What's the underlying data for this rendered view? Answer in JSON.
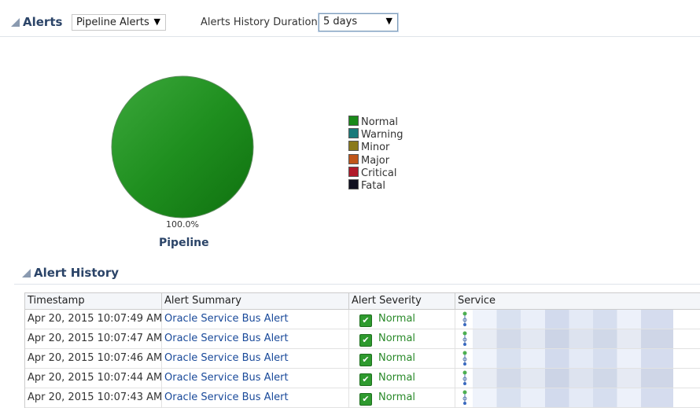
{
  "header": {
    "title": "Alerts",
    "pipeline_select": "Pipeline Alerts",
    "duration_label": "Alerts History Duration",
    "duration_select": "5 days"
  },
  "chart_data": {
    "type": "pie",
    "title": "Pipeline",
    "slices": [
      {
        "label": "Normal",
        "value": 100.0,
        "color": "#1a8a1a"
      },
      {
        "label": "Warning",
        "value": 0,
        "color": "#1a7a7a"
      },
      {
        "label": "Minor",
        "value": 0,
        "color": "#8a7a1a"
      },
      {
        "label": "Major",
        "value": 0,
        "color": "#c0561a"
      },
      {
        "label": "Critical",
        "value": 0,
        "color": "#b01a2a"
      },
      {
        "label": "Fatal",
        "value": 0,
        "color": "#101020"
      }
    ],
    "data_label": "100.0%",
    "legend": "right"
  },
  "history": {
    "title": "Alert History",
    "columns": [
      "Timestamp",
      "Alert Summary",
      "Alert Severity",
      "Service"
    ],
    "rows": [
      {
        "timestamp": "Apr 20, 2015 10:07:49 AM",
        "summary": "Oracle Service Bus Alert",
        "severity": "Normal"
      },
      {
        "timestamp": "Apr 20, 2015 10:07:47 AM",
        "summary": "Oracle Service Bus Alert",
        "severity": "Normal"
      },
      {
        "timestamp": "Apr 20, 2015 10:07:46 AM",
        "summary": "Oracle Service Bus Alert",
        "severity": "Normal"
      },
      {
        "timestamp": "Apr 20, 2015 10:07:44 AM",
        "summary": "Oracle Service Bus Alert",
        "severity": "Normal"
      },
      {
        "timestamp": "Apr 20, 2015 10:07:43 AM",
        "summary": "Oracle Service Bus Alert",
        "severity": "Normal"
      }
    ]
  }
}
